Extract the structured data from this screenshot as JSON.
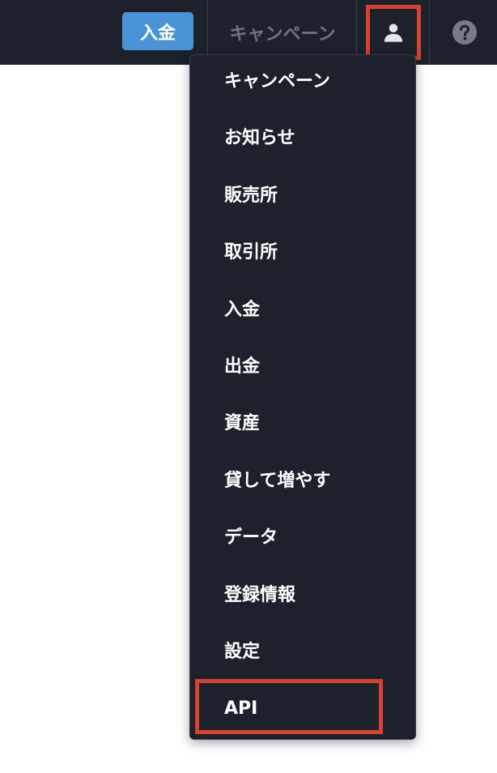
{
  "header": {
    "deposit_label": "入金",
    "campaign_label": "キャンペーン",
    "account_icon": "user-icon",
    "help_icon": "question-circle-icon"
  },
  "menu": {
    "items": [
      {
        "label": "キャンペーン"
      },
      {
        "label": "お知らせ"
      },
      {
        "label": "販売所"
      },
      {
        "label": "取引所"
      },
      {
        "label": "入金"
      },
      {
        "label": "出金"
      },
      {
        "label": "資産"
      },
      {
        "label": "貸して増やす"
      },
      {
        "label": "データ"
      },
      {
        "label": "登録情報"
      },
      {
        "label": "設定"
      },
      {
        "label": "API"
      }
    ]
  },
  "colors": {
    "navbar_bg": "#1d212c",
    "accent_blue": "#4a93d6",
    "highlight_red": "#d9402f",
    "muted_text": "#6f7480"
  }
}
